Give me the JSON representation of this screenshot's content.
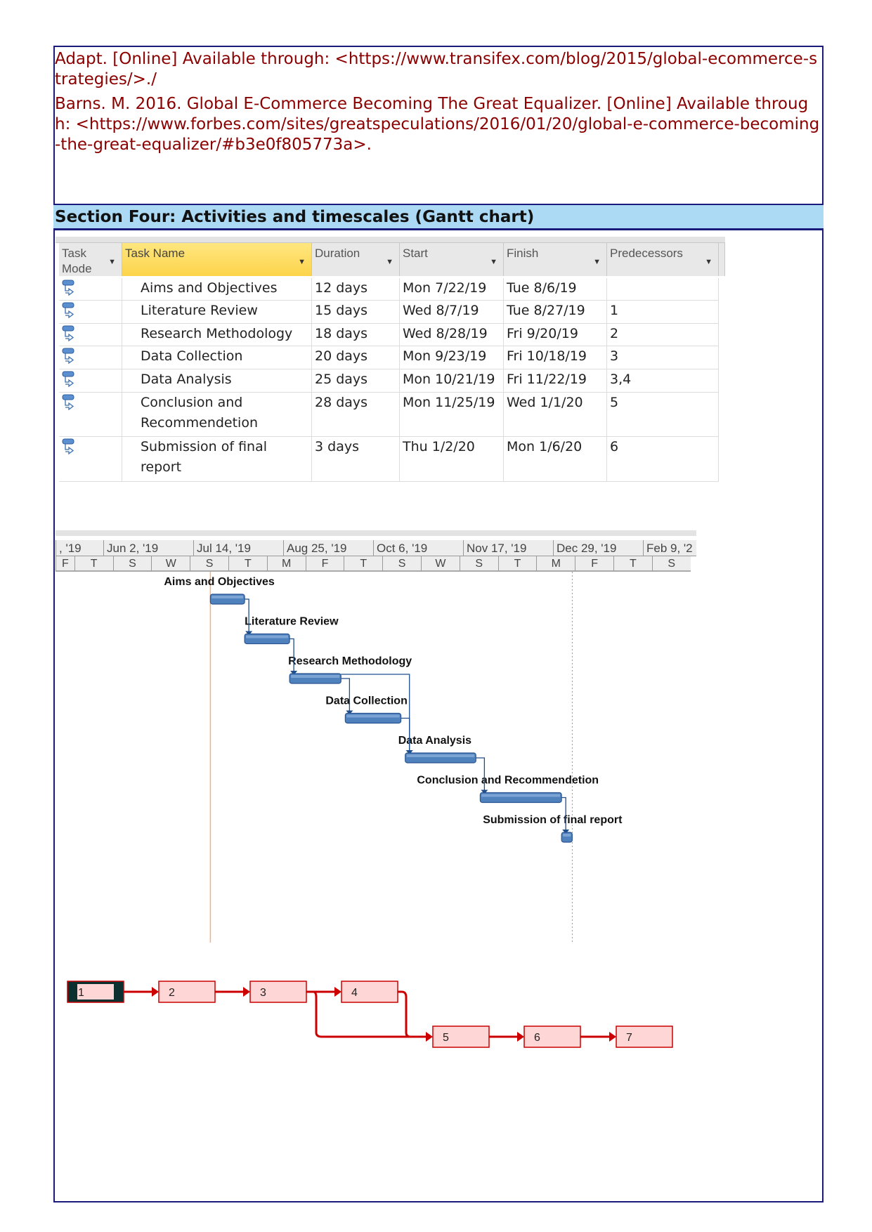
{
  "references": [
    "Adapt. [Online] Available through: <https://www.transifex.com/blog/2015/global-ecommerce-strategies/>./",
    "Barns. M. 2016. Global E-Commerce Becoming The Great Equalizer. [Online] Available through: <https://www.forbes.com/sites/greatspeculations/2016/01/20/global-e-commerce-becoming-the-great-equalizer/#b3e0f805773a>."
  ],
  "section_title": "Section Four: Activities and timescales (Gantt chart)",
  "table": {
    "headers": [
      "Task Mode",
      "Task Name",
      "Duration",
      "Start",
      "Finish",
      "Predecessors"
    ],
    "rows": [
      {
        "mode": "auto-scheduled-icon",
        "name": "Aims and Objectives",
        "duration": "12 days",
        "start": "Mon 7/22/19",
        "finish": "Tue 8/6/19",
        "pred": ""
      },
      {
        "mode": "auto-scheduled-icon",
        "name": "Literature Review",
        "duration": "15 days",
        "start": "Wed 8/7/19",
        "finish": "Tue 8/27/19",
        "pred": "1"
      },
      {
        "mode": "auto-scheduled-icon",
        "name": "Research Methodology",
        "duration": "18 days",
        "start": "Wed 8/28/19",
        "finish": "Fri 9/20/19",
        "pred": "2"
      },
      {
        "mode": "auto-scheduled-icon",
        "name": "Data Collection",
        "duration": "20 days",
        "start": "Mon 9/23/19",
        "finish": "Fri 10/18/19",
        "pred": "3"
      },
      {
        "mode": "auto-scheduled-icon",
        "name": "Data Analysis",
        "duration": "25 days",
        "start": "Mon 10/21/19",
        "finish": "Fri 11/22/19",
        "pred": "3,4"
      },
      {
        "mode": "auto-scheduled-icon",
        "name": "Conclusion and Recommendetion",
        "duration": "28 days",
        "start": "Mon 11/25/19",
        "finish": "Wed 1/1/20",
        "pred": "5"
      },
      {
        "mode": "auto-scheduled-icon",
        "name": "Submission of final report",
        "duration": "3 days",
        "start": "Thu 1/2/20",
        "finish": "Mon 1/6/20",
        "pred": "6"
      }
    ]
  },
  "gantt": {
    "major_ticks": [
      ", '19",
      "Jun 2, '19",
      "Jul 14, '19",
      "Aug 25, '19",
      "Oct 6, '19",
      "Nov 17, '19",
      "Dec 29, '19",
      "Feb 9, '2"
    ],
    "minor_ticks": [
      "F",
      "T",
      "S",
      "W",
      "S",
      "T",
      "M",
      "F",
      "T",
      "S",
      "W",
      "S",
      "T",
      "M",
      "F",
      "T",
      "S"
    ],
    "tasks": [
      {
        "label": "Aims and Objectives",
        "start": "2019-07-22",
        "finish": "2019-08-06",
        "pred": []
      },
      {
        "label": "Literature Review",
        "start": "2019-08-07",
        "finish": "2019-08-27",
        "pred": [
          0
        ]
      },
      {
        "label": "Research Methodology",
        "start": "2019-08-28",
        "finish": "2019-09-20",
        "pred": [
          1
        ]
      },
      {
        "label": "Data Collection",
        "start": "2019-09-23",
        "finish": "2019-10-18",
        "pred": [
          2
        ]
      },
      {
        "label": "Data Analysis",
        "start": "2019-10-21",
        "finish": "2019-11-22",
        "pred": [
          2,
          3
        ]
      },
      {
        "label": "Conclusion and Recommendetion",
        "start": "2019-11-25",
        "finish": "2020-01-01",
        "pred": [
          4
        ]
      },
      {
        "label": "Submission of final report",
        "start": "2020-01-02",
        "finish": "2020-01-06",
        "pred": [
          5
        ]
      }
    ],
    "bar_color": "#4f81bd",
    "today_line_color": "#f4b183"
  },
  "network": {
    "nodes": [
      "1",
      "2",
      "3",
      "4",
      "5",
      "6",
      "7"
    ],
    "edges": [
      [
        1,
        2
      ],
      [
        2,
        3
      ],
      [
        3,
        4
      ],
      [
        3,
        5
      ],
      [
        4,
        5
      ],
      [
        5,
        6
      ],
      [
        6,
        7
      ]
    ],
    "line_color": "#cc0000",
    "fill_color": "#ffd6d6"
  }
}
